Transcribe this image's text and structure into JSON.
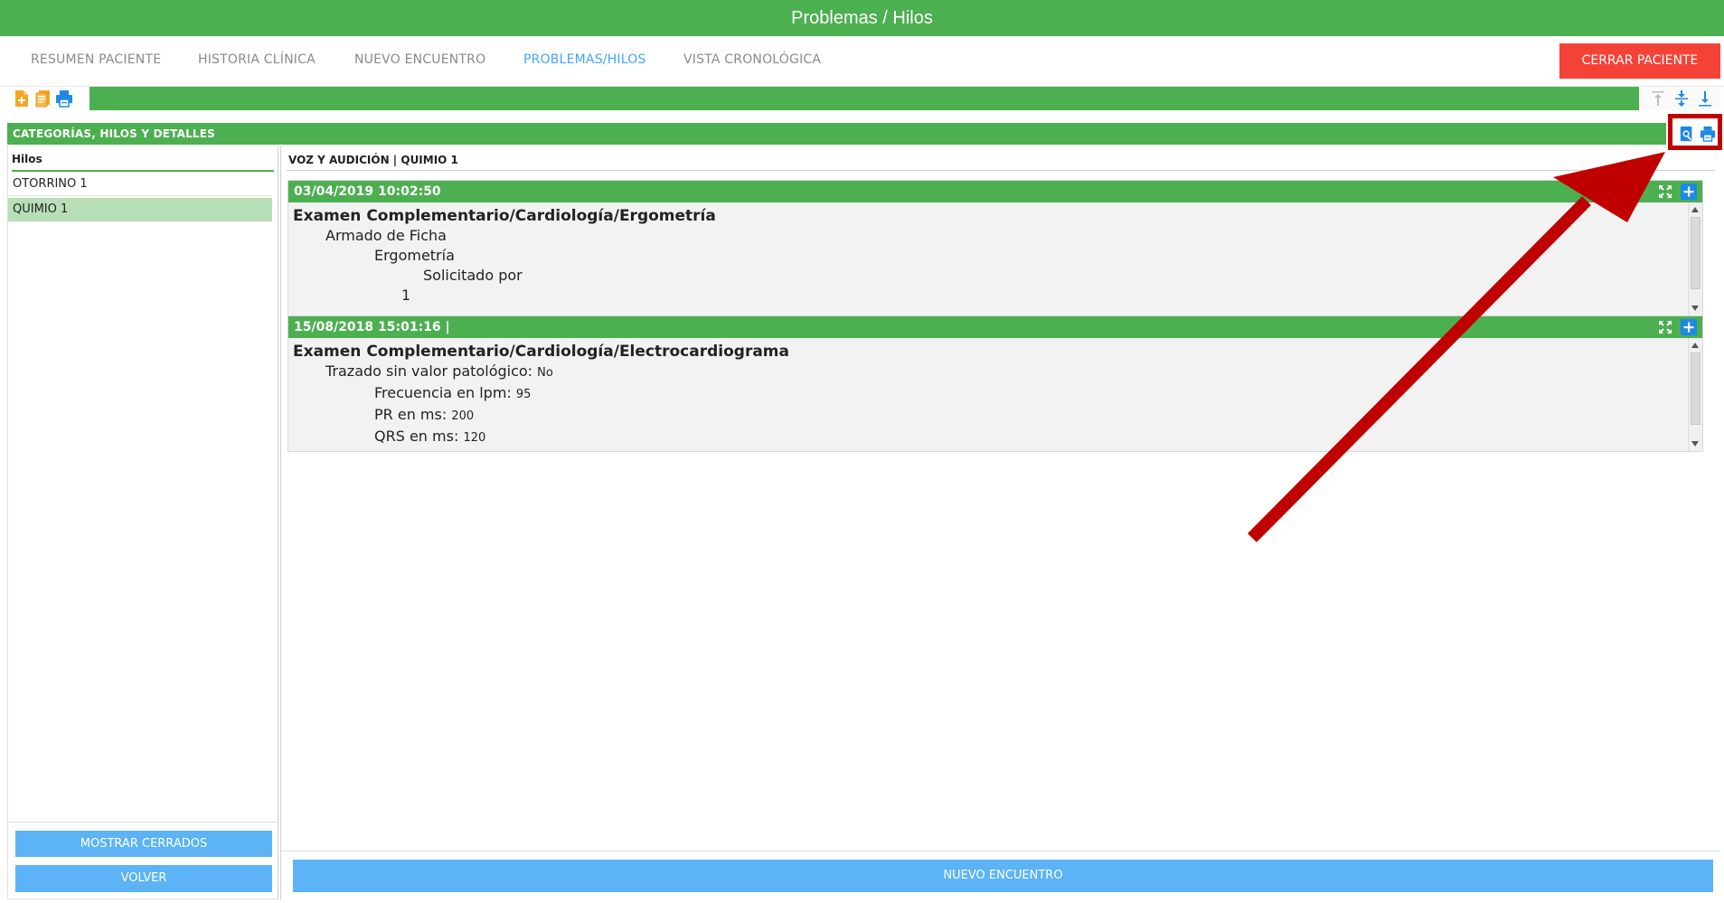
{
  "window": {
    "title": "Problemas / Hilos"
  },
  "nav": {
    "tabs": [
      {
        "label": "RESUMEN PACIENTE",
        "active": false
      },
      {
        "label": "HISTORIA CLÍNICA",
        "active": false
      },
      {
        "label": "NUEVO ENCUENTRO",
        "active": false
      },
      {
        "label": "PROBLEMAS/HILOS",
        "active": true
      },
      {
        "label": "VISTA CRONOLÓGICA",
        "active": false
      }
    ],
    "close_label": "CERRAR PACIENTE"
  },
  "toolbar": {
    "icons": [
      "new-document-icon",
      "notebook-icon",
      "print-icon"
    ],
    "nav_icons": [
      "scroll-top-icon",
      "collapse-all-icon",
      "scroll-bottom-icon"
    ]
  },
  "section": {
    "title": "CATEGORÍAS, HILOS Y DETALLES",
    "tools": [
      "preview-icon",
      "print-icon"
    ]
  },
  "left": {
    "heading": "Hilos",
    "items": [
      {
        "label": "OTORRINO 1",
        "selected": false
      },
      {
        "label": "QUIMIO 1",
        "selected": true
      }
    ],
    "show_closed_label": "MOSTRAR CERRADOS",
    "back_label": "VOLVER"
  },
  "main": {
    "breadcrumb": "VOZ Y AUDICIÓN | QUIMIO 1",
    "entries": [
      {
        "timestamp": "03/04/2019 10:02:50",
        "title": "Examen Complementario/Cardiología/Ergometría",
        "l1": "Armado de Ficha",
        "l2": "Ergometría",
        "l3": "Solicitado por",
        "l4": "1"
      },
      {
        "timestamp": "15/08/2018 15:01:16 |",
        "title": "Examen Complementario/Cardiología/Electrocardiograma",
        "f1_label": "Trazado sin valor patológico:",
        "f1_value": "No",
        "f2_label": "Frecuencia en lpm:",
        "f2_value": "95",
        "f3_label": "PR en ms:",
        "f3_value": "200",
        "f4_label": "QRS en ms:",
        "f4_value": "120"
      }
    ],
    "new_encounter_label": "NUEVO ENCUENTRO"
  },
  "colors": {
    "header_green": "#4caf50",
    "active_tab": "#42a5f5",
    "close_red": "#f44336",
    "button_blue": "#5cb3f5",
    "selected_row": "#b8dfb8",
    "annotation_red": "#c00000"
  }
}
